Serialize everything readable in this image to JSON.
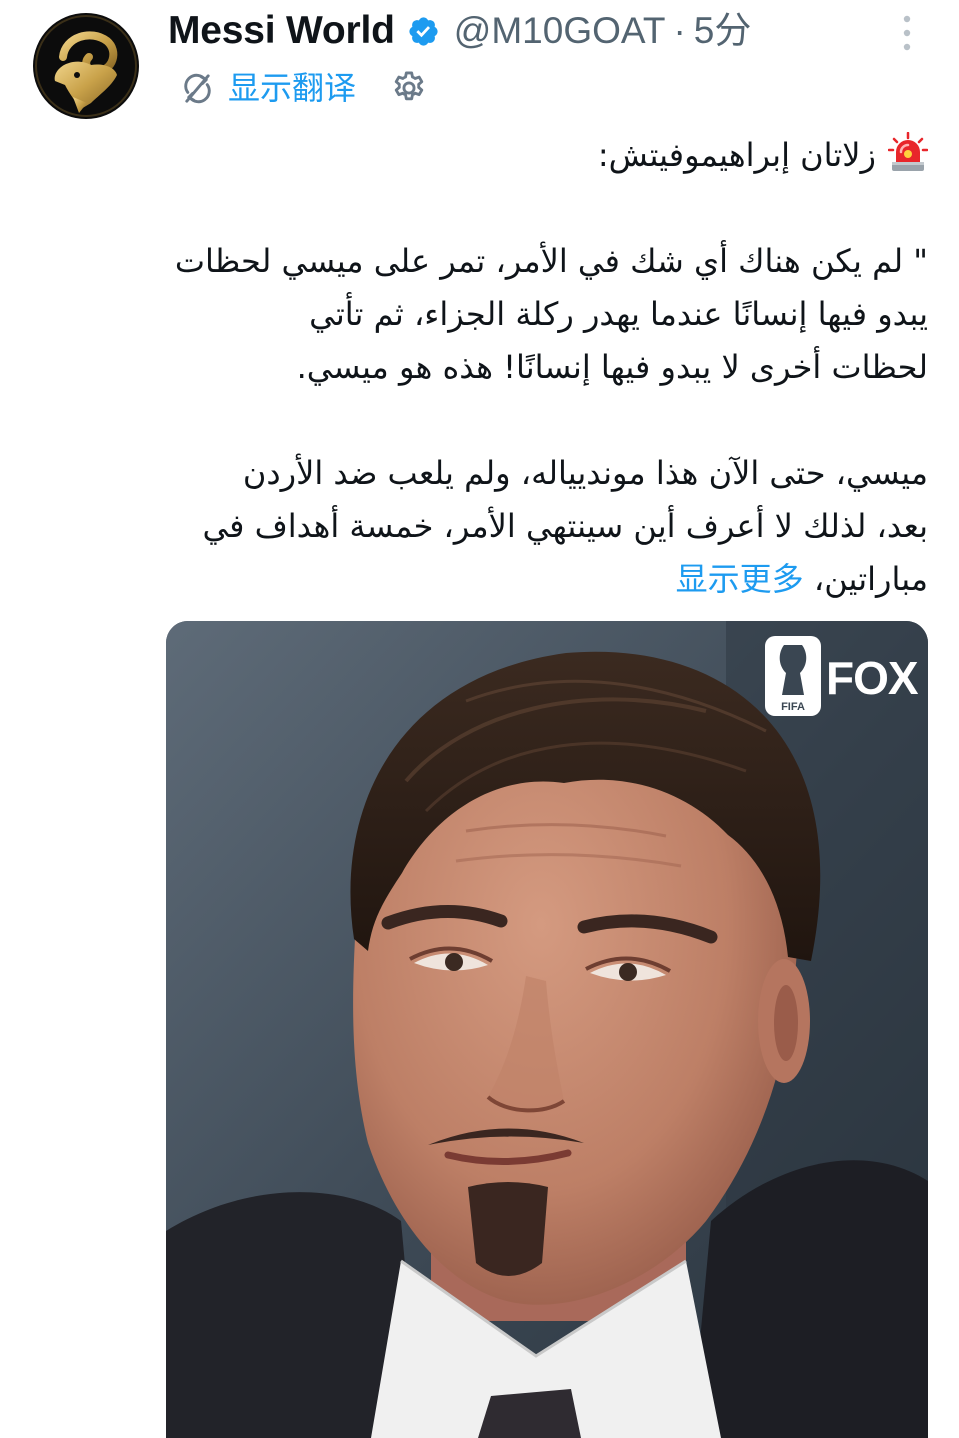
{
  "colors": {
    "text": "#0f1419",
    "secondary": "#536471",
    "accent": "#1d9bf0",
    "muted": "#b9c1c8",
    "avatar_gold": "#c9a24a"
  },
  "icons": {
    "avatar": "goat-logo-avatar",
    "verified": "verified-badge-icon",
    "more": "more-vertical-icon",
    "translate": "translate-icon",
    "settings": "gear-icon",
    "lead": "siren-emoji-icon"
  },
  "tweet": {
    "author": {
      "name": "Messi World",
      "handle": "@M10GOAT",
      "separator": "·",
      "time": "5分"
    },
    "translate_label": "显示翻译",
    "body": {
      "title": "زلاتان إبراهيموفيتش:",
      "quote_lines": [
        "\" لم يكن هناك أي شك في الأمر، تمر على ميسي لحظات",
        "يبدو فيها إنسانًا عندما يهدر ركلة الجزاء، ثم تأتي",
        "لحظات أخرى لا يبدو فيها إنسانًا! هذه هو ميسي."
      ],
      "para_lines": [
        "ميسي، حتى الآن هذا مونديياله، ولم يلعب ضد الأردن",
        "بعد، لذلك لا أعرف أين سينتهي الأمر، خمسة أهداف في",
        "مباراتين،"
      ],
      "show_more": "显示更多"
    },
    "media": {
      "watermark_brand": "FOX",
      "watermark_badge": "FIFA"
    }
  }
}
